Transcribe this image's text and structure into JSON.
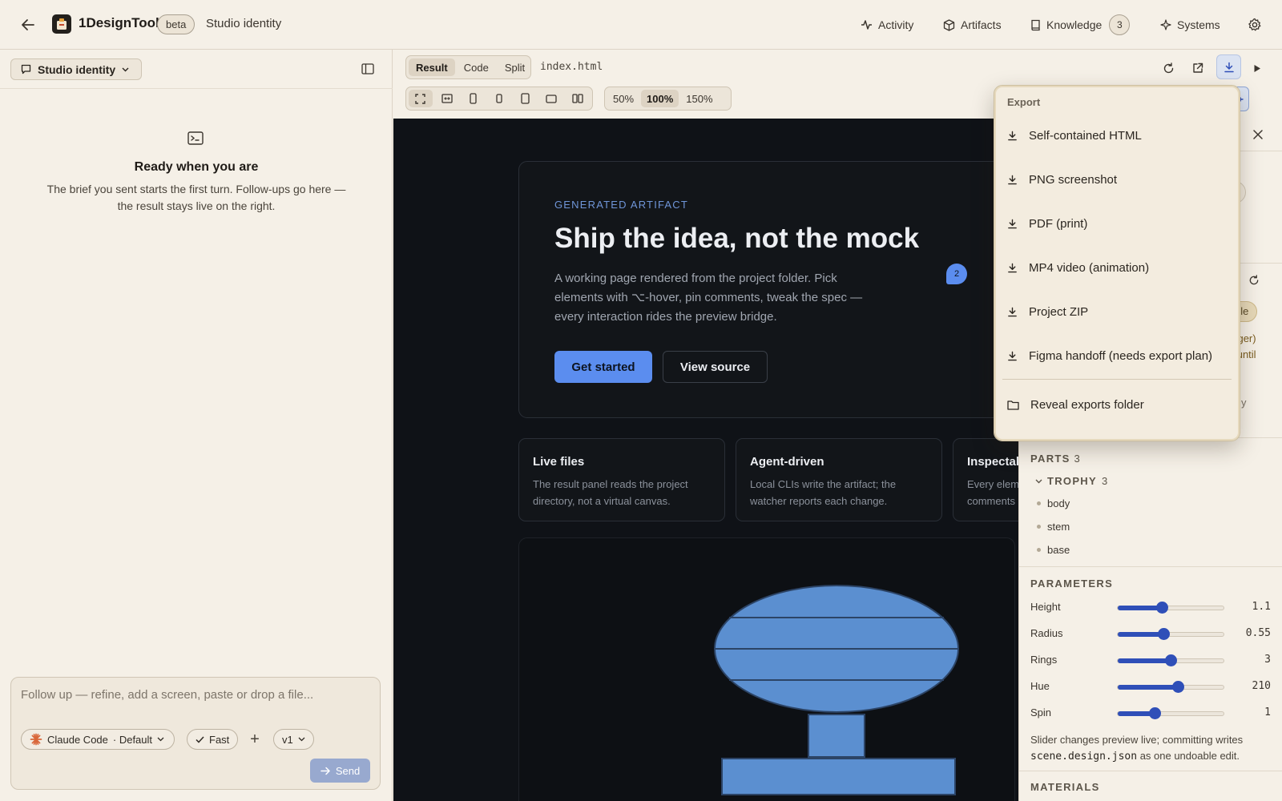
{
  "app": {
    "name": "1DesignTool",
    "badge": "beta",
    "crumb": "Studio identity"
  },
  "nav": [
    {
      "label": "Activity",
      "icon": "activity-icon"
    },
    {
      "label": "Artifacts",
      "icon": "cube-icon"
    },
    {
      "label": "Knowledge",
      "icon": "book-icon",
      "count": "3"
    },
    {
      "label": "Systems",
      "icon": "sparkle-icon"
    }
  ],
  "left": {
    "session": "Studio identity",
    "ready_title": "Ready when you are",
    "ready_sub": "The brief you sent starts the first turn. Follow-ups go here — the result stays live on the right.",
    "composer_placeholder": "Follow up — refine, add a screen, paste or drop a file...",
    "model": "Claude Code",
    "model_mode": "· Default",
    "fast": "Fast",
    "plus": "+",
    "version": "v1",
    "send": "Send"
  },
  "toolbar": {
    "tabs": [
      "Result",
      "Code",
      "Split"
    ],
    "active_tab": "Result",
    "filename": "index.html",
    "zoom": [
      "50%",
      "100%",
      "150%"
    ],
    "active_zoom": "100%"
  },
  "preview": {
    "eyebrow": "GENERATED ARTIFACT",
    "headline": "Ship the idea, not the mock",
    "body": "A working page rendered from the project folder. Pick elements with ⌥-hover, pin comments, tweak the spec — every interaction rides the preview bridge.",
    "cta_primary": "Get started",
    "cta_secondary": "View source",
    "pin": "2",
    "features": [
      {
        "title": "Live files",
        "desc": "The result panel reads the project directory, not a virtual canvas."
      },
      {
        "title": "Agent-driven",
        "desc": "Local CLIs write the artifact; the watcher reports each change."
      },
      {
        "title": "Inspectab",
        "desc": "Every elem comments"
      }
    ],
    "trophy_color": "#5b8fd0"
  },
  "inspector": {
    "chip": "ble",
    "warn_1": "nager)",
    "warn_2": "until",
    "fragment": "y",
    "parts_label": "PARTS",
    "parts_count": "3",
    "group_label": "TROPHY",
    "group_count": "3",
    "parts": [
      "body",
      "stem",
      "base"
    ],
    "params_label": "PARAMETERS",
    "params": [
      {
        "label": "Height",
        "value": "1.1",
        "level": 0.42
      },
      {
        "label": "Radius",
        "value": "0.55",
        "level": 0.43
      },
      {
        "label": "Rings",
        "value": "3",
        "level": 0.5
      },
      {
        "label": "Hue",
        "value": "210",
        "level": 0.57
      },
      {
        "label": "Spin",
        "value": "1",
        "level": 0.35
      }
    ],
    "note_pre": "Slider changes preview live; committing writes",
    "note_code": "scene.design.json",
    "note_post": "as one undoable edit.",
    "materials_label": "MATERIALS"
  },
  "export": {
    "title": "Export",
    "items": [
      "Self-contained HTML",
      "PNG screenshot",
      "PDF (print)",
      "MP4 video (animation)",
      "Project ZIP",
      "Figma handoff (needs export plan)"
    ],
    "reveal": "Reveal exports folder"
  },
  "colors": {
    "accent": "#5b8def",
    "slider": "#2f4fb8",
    "background": "#f4efe6",
    "preview_bg": "#0f1217"
  }
}
